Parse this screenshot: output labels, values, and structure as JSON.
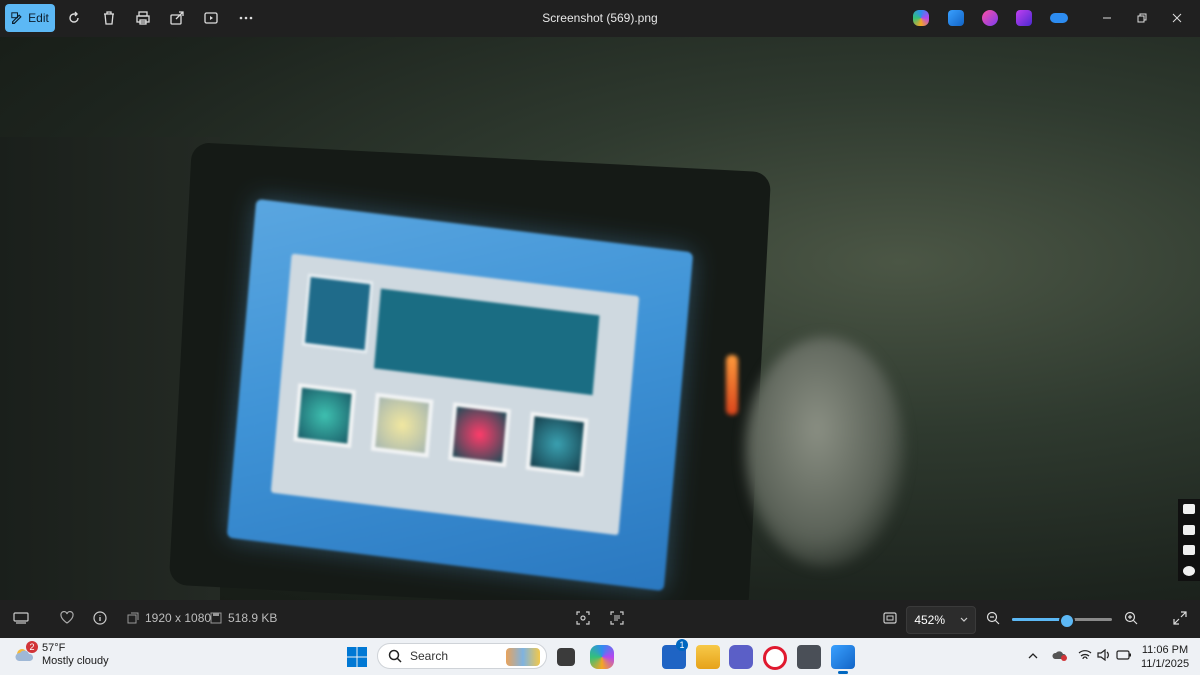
{
  "toolbar": {
    "edit_label": "Edit",
    "file_title": "Screenshot (569).png",
    "icons": [
      "edit-icon",
      "rotate-icon",
      "delete-icon",
      "print-icon",
      "share-icon",
      "slideshow-icon",
      "more-icon"
    ],
    "app_badges": [
      "copilot-icon",
      "photos-designer-icon",
      "clipchamp-icon",
      "video-editor-icon",
      "onedrive-icon"
    ],
    "window_controls": [
      "minimize-icon",
      "restore-icon",
      "close-icon"
    ]
  },
  "status": {
    "dimensions": "1920 x 1080",
    "file_size": "518.9 KB",
    "zoom_value": "452%",
    "zoom_fraction": 0.55,
    "colors": {
      "accent": "#5cb8f5"
    }
  },
  "taskbar": {
    "weather_badge": "2",
    "temperature": "57°F",
    "condition": "Mostly cloudy",
    "search_placeholder": "Search",
    "store_badge": "1",
    "time": "11:06 PM",
    "date": "11/1/2025"
  }
}
